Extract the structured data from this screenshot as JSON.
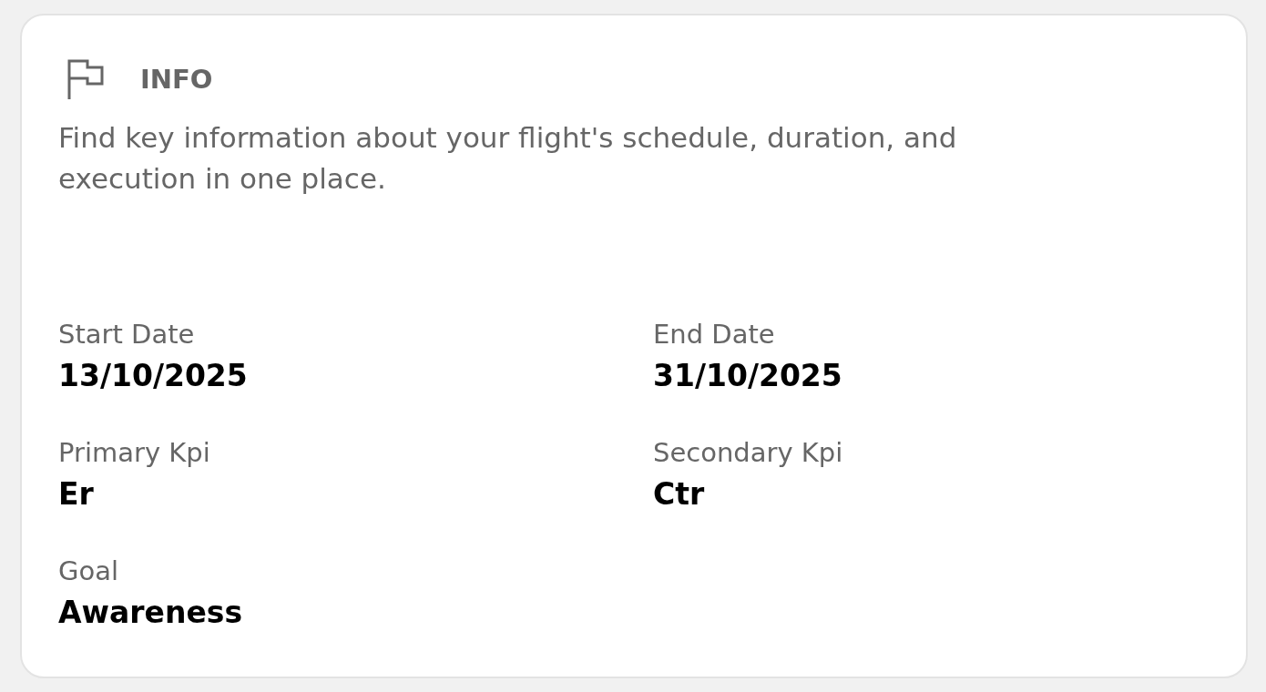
{
  "header": {
    "title": "INFO",
    "description": "Find key information about your flight's schedule, duration, and execution in one place."
  },
  "fields": [
    {
      "label": "Start Date",
      "value": "13/10/2025"
    },
    {
      "label": "End Date",
      "value": "31/10/2025"
    },
    {
      "label": "Primary Kpi",
      "value": "Er"
    },
    {
      "label": "Secondary Kpi",
      "value": "Ctr"
    },
    {
      "label": "Goal",
      "value": "Awareness"
    }
  ]
}
